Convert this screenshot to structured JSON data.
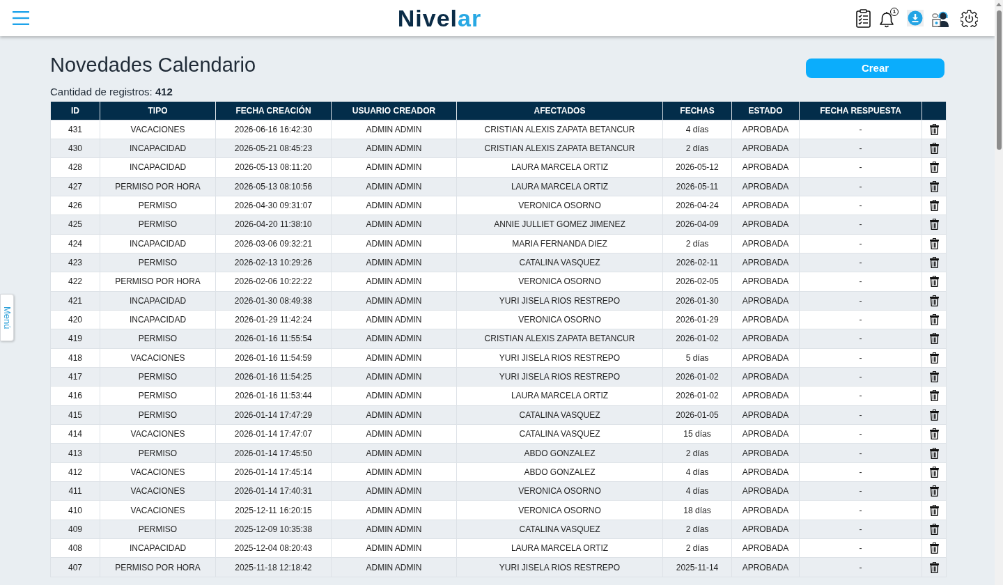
{
  "header": {
    "logo_parts": [
      "Nivel",
      "ar"
    ],
    "notification_count": "1"
  },
  "side_tab": {
    "label": "Menú"
  },
  "page": {
    "title": "Novedades Calendario",
    "record_count": "Cantidad de registros: **412**",
    "create_button": "Crear"
  },
  "table": {
    "columns": [
      "ID",
      "TIPO",
      "FECHA CREACIÓN",
      "USUARIO CREADOR",
      "AFECTADOS",
      "FECHAS",
      "ESTADO",
      "FECHA RESPUESTA"
    ],
    "rows": [
      {
        "cells": [
          "431",
          "VACACIONES",
          "2026-06-16 16:42:30",
          "ADMIN ADMIN",
          "CRISTIAN ALEXIS ZAPATA BETANCUR",
          "4 días",
          "APROBADA",
          "-"
        ]
      },
      {
        "cells": [
          "430",
          "INCAPACIDAD",
          "2026-05-21 08:45:23",
          "ADMIN ADMIN",
          "CRISTIAN ALEXIS ZAPATA BETANCUR",
          "2 días",
          "APROBADA",
          "-"
        ]
      },
      {
        "cells": [
          "428",
          "INCAPACIDAD",
          "2026-05-13 08:11:20",
          "ADMIN ADMIN",
          "LAURA MARCELA ORTIZ",
          "2026-05-12",
          "APROBADA",
          "-"
        ]
      },
      {
        "cells": [
          "427",
          "PERMISO POR HORA",
          "2026-05-13 08:10:56",
          "ADMIN ADMIN",
          "LAURA MARCELA ORTIZ",
          "2026-05-11",
          "APROBADA",
          "-"
        ]
      },
      {
        "cells": [
          "426",
          "PERMISO",
          "2026-04-30 09:31:07",
          "ADMIN ADMIN",
          "VERONICA OSORNO",
          "2026-04-24",
          "APROBADA",
          "-"
        ]
      },
      {
        "cells": [
          "425",
          "PERMISO",
          "2026-04-20 11:38:10",
          "ADMIN ADMIN",
          "ANNIE JULLIET GOMEZ JIMENEZ",
          "2026-04-09",
          "APROBADA",
          "-"
        ]
      },
      {
        "cells": [
          "424",
          "INCAPACIDAD",
          "2026-03-06 09:32:21",
          "ADMIN ADMIN",
          "MARIA FERNANDA DIEZ",
          "2 días",
          "APROBADA",
          "-"
        ]
      },
      {
        "cells": [
          "423",
          "PERMISO",
          "2026-02-13 10:29:26",
          "ADMIN ADMIN",
          "CATALINA VASQUEZ",
          "2026-02-11",
          "APROBADA",
          "-"
        ]
      },
      {
        "cells": [
          "422",
          "PERMISO POR HORA",
          "2026-02-06 10:22:22",
          "ADMIN ADMIN",
          "VERONICA OSORNO",
          "2026-02-05",
          "APROBADA",
          "-"
        ]
      },
      {
        "cells": [
          "421",
          "INCAPACIDAD",
          "2026-01-30 08:49:38",
          "ADMIN ADMIN",
          "YURI JISELA RIOS RESTREPO",
          "2026-01-30",
          "APROBADA",
          "-"
        ]
      },
      {
        "cells": [
          "420",
          "INCAPACIDAD",
          "2026-01-29 11:42:24",
          "ADMIN ADMIN",
          "VERONICA OSORNO",
          "2026-01-29",
          "APROBADA",
          "-"
        ]
      },
      {
        "cells": [
          "419",
          "PERMISO",
          "2026-01-16 11:55:54",
          "ADMIN ADMIN",
          "CRISTIAN ALEXIS ZAPATA BETANCUR",
          "2026-01-02",
          "APROBADA",
          "-"
        ]
      },
      {
        "cells": [
          "418",
          "VACACIONES",
          "2026-01-16 11:54:59",
          "ADMIN ADMIN",
          "YURI JISELA RIOS RESTREPO",
          "5 días",
          "APROBADA",
          "-"
        ]
      },
      {
        "cells": [
          "417",
          "PERMISO",
          "2026-01-16 11:54:25",
          "ADMIN ADMIN",
          "YURI JISELA RIOS RESTREPO",
          "2026-01-02",
          "APROBADA",
          "-"
        ]
      },
      {
        "cells": [
          "416",
          "PERMISO",
          "2026-01-16 11:53:44",
          "ADMIN ADMIN",
          "LAURA MARCELA ORTIZ",
          "2026-01-02",
          "APROBADA",
          "-"
        ]
      },
      {
        "cells": [
          "415",
          "PERMISO",
          "2026-01-14 17:47:29",
          "ADMIN ADMIN",
          "CATALINA VASQUEZ",
          "2026-01-05",
          "APROBADA",
          "-"
        ]
      },
      {
        "cells": [
          "414",
          "VACACIONES",
          "2026-01-14 17:47:07",
          "ADMIN ADMIN",
          "CATALINA VASQUEZ",
          "15 días",
          "APROBADA",
          "-"
        ]
      },
      {
        "cells": [
          "413",
          "PERMISO",
          "2026-01-14 17:45:50",
          "ADMIN ADMIN",
          "ABDO GONZALEZ",
          "2 días",
          "APROBADA",
          "-"
        ]
      },
      {
        "cells": [
          "412",
          "VACACIONES",
          "2026-01-14 17:45:14",
          "ADMIN ADMIN",
          "ABDO GONZALEZ",
          "4 días",
          "APROBADA",
          "-"
        ]
      },
      {
        "cells": [
          "411",
          "VACACIONES",
          "2026-01-14 17:40:31",
          "ADMIN ADMIN",
          "VERONICA OSORNO",
          "4 días",
          "APROBADA",
          "-"
        ]
      },
      {
        "cells": [
          "410",
          "VACACIONES",
          "2025-12-11 16:20:15",
          "ADMIN ADMIN",
          "VERONICA OSORNO",
          "18 días",
          "APROBADA",
          "-"
        ]
      },
      {
        "cells": [
          "409",
          "PERMISO",
          "2025-12-09 10:35:38",
          "ADMIN ADMIN",
          "CATALINA VASQUEZ",
          "2 días",
          "APROBADA",
          "-"
        ]
      },
      {
        "cells": [
          "408",
          "INCAPACIDAD",
          "2025-12-04 08:20:43",
          "ADMIN ADMIN",
          "LAURA MARCELA ORTIZ",
          "2 días",
          "APROBADA",
          "-"
        ]
      },
      {
        "cells": [
          "407",
          "PERMISO POR HORA",
          "2025-11-18 12:18:42",
          "ADMIN ADMIN",
          "YURI JISELA RIOS RESTREPO",
          "2025-11-14",
          "APROBADA",
          "-"
        ]
      }
    ]
  }
}
